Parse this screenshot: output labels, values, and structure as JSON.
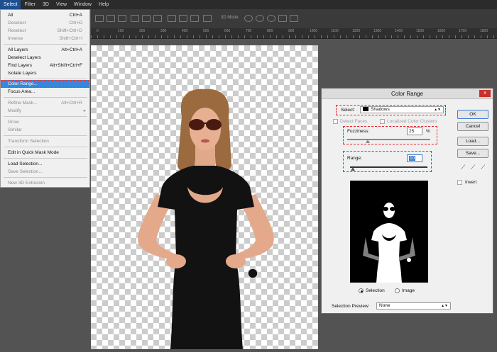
{
  "menubar": [
    "Select",
    "Filter",
    "3D",
    "View",
    "Window",
    "Help"
  ],
  "options_bar": {
    "mode_label": "3D Mode:"
  },
  "ruler_ticks": [
    "0",
    "100",
    "200",
    "300",
    "400",
    "500",
    "600",
    "700",
    "800",
    "900",
    "1000",
    "1100",
    "1200",
    "1300",
    "1400",
    "1500",
    "1600",
    "1700",
    "1800"
  ],
  "select_menu": {
    "items": [
      {
        "label": "All",
        "shortcut": "Ctrl+A",
        "enabled": true
      },
      {
        "label": "Deselect",
        "shortcut": "Ctrl+D",
        "enabled": false
      },
      {
        "label": "Reselect",
        "shortcut": "Shift+Ctrl+D",
        "enabled": false
      },
      {
        "label": "Inverse",
        "shortcut": "Shift+Ctrl+I",
        "enabled": false
      },
      {
        "label": "All Layers",
        "shortcut": "Alt+Ctrl+A",
        "enabled": true
      },
      {
        "label": "Deselect Layers",
        "shortcut": "",
        "enabled": true
      },
      {
        "label": "Find Layers",
        "shortcut": "Alt+Shift+Ctrl+F",
        "enabled": true
      },
      {
        "label": "Isolate Layers",
        "shortcut": "",
        "enabled": true
      },
      {
        "label": "Color Range...",
        "shortcut": "",
        "enabled": true,
        "highlighted": true
      },
      {
        "label": "Focus Area...",
        "shortcut": "",
        "enabled": true
      },
      {
        "label": "Refine Mask...",
        "shortcut": "Alt+Ctrl+R",
        "enabled": false
      },
      {
        "label": "Modify",
        "shortcut": "",
        "enabled": false,
        "submenu": true
      },
      {
        "label": "Grow",
        "shortcut": "",
        "enabled": false
      },
      {
        "label": "Similar",
        "shortcut": "",
        "enabled": false
      },
      {
        "label": "Transform Selection",
        "shortcut": "",
        "enabled": false
      },
      {
        "label": "Edit in Quick Mask Mode",
        "shortcut": "",
        "enabled": true
      },
      {
        "label": "Load Selection...",
        "shortcut": "",
        "enabled": true
      },
      {
        "label": "Save Selection...",
        "shortcut": "",
        "enabled": false
      },
      {
        "label": "New 3D Extrusion",
        "shortcut": "",
        "enabled": false
      }
    ]
  },
  "dialog": {
    "title": "Color Range",
    "select_label": "Select:",
    "select_value": "Shadows",
    "detect_faces": "Detect Faces",
    "localized": "Localized Color Clusters",
    "fuzziness_label": "Fuzziness:",
    "fuzziness_value": "25",
    "fuzziness_unit": "%",
    "fuzziness_level": 0.25,
    "range_label": "Range:",
    "range_value": "10",
    "range_level": 0.04,
    "radio_selection": "Selection",
    "radio_image": "Image",
    "preview_label": "Selection Preview:",
    "preview_value": "None",
    "buttons": {
      "ok": "OK",
      "cancel": "Cancel",
      "load": "Load...",
      "save": "Save..."
    },
    "invert": "Invert",
    "close_glyph": "x"
  },
  "colors": {
    "highlight": "#3a86d8",
    "annotation": "#e8242a",
    "menubar": "#2b2b2b"
  }
}
